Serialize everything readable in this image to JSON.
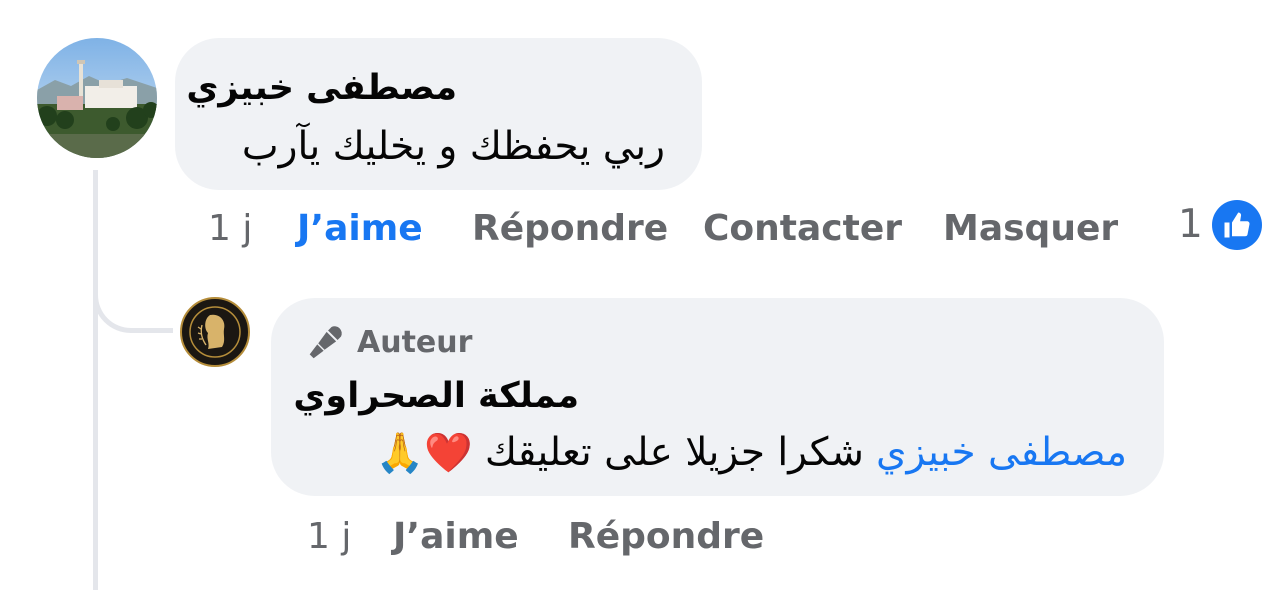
{
  "comment": {
    "author": "مصطفى خبيزي",
    "text": "ربي يحفظك و يخليك يآرب",
    "time": "1 j",
    "actions": {
      "like": "J’aime",
      "reply": "Répondre",
      "contact": "Contacter",
      "hide": "Masquer"
    },
    "like_count": "1",
    "liked": true
  },
  "reply": {
    "badge": "Auteur",
    "badge_icon": "microphone-icon",
    "author": "مملكة الصحراوي",
    "mention": "مصطفى خبيزي",
    "text": "شكرا جزيلا على تعليقك",
    "emojis": "❤️🙏",
    "time": "1 j",
    "actions": {
      "like": "J’aime",
      "reply": "Répondre"
    }
  },
  "colors": {
    "accent": "#1877f2",
    "bubble": "#f0f2f5",
    "muted": "#65676b"
  }
}
